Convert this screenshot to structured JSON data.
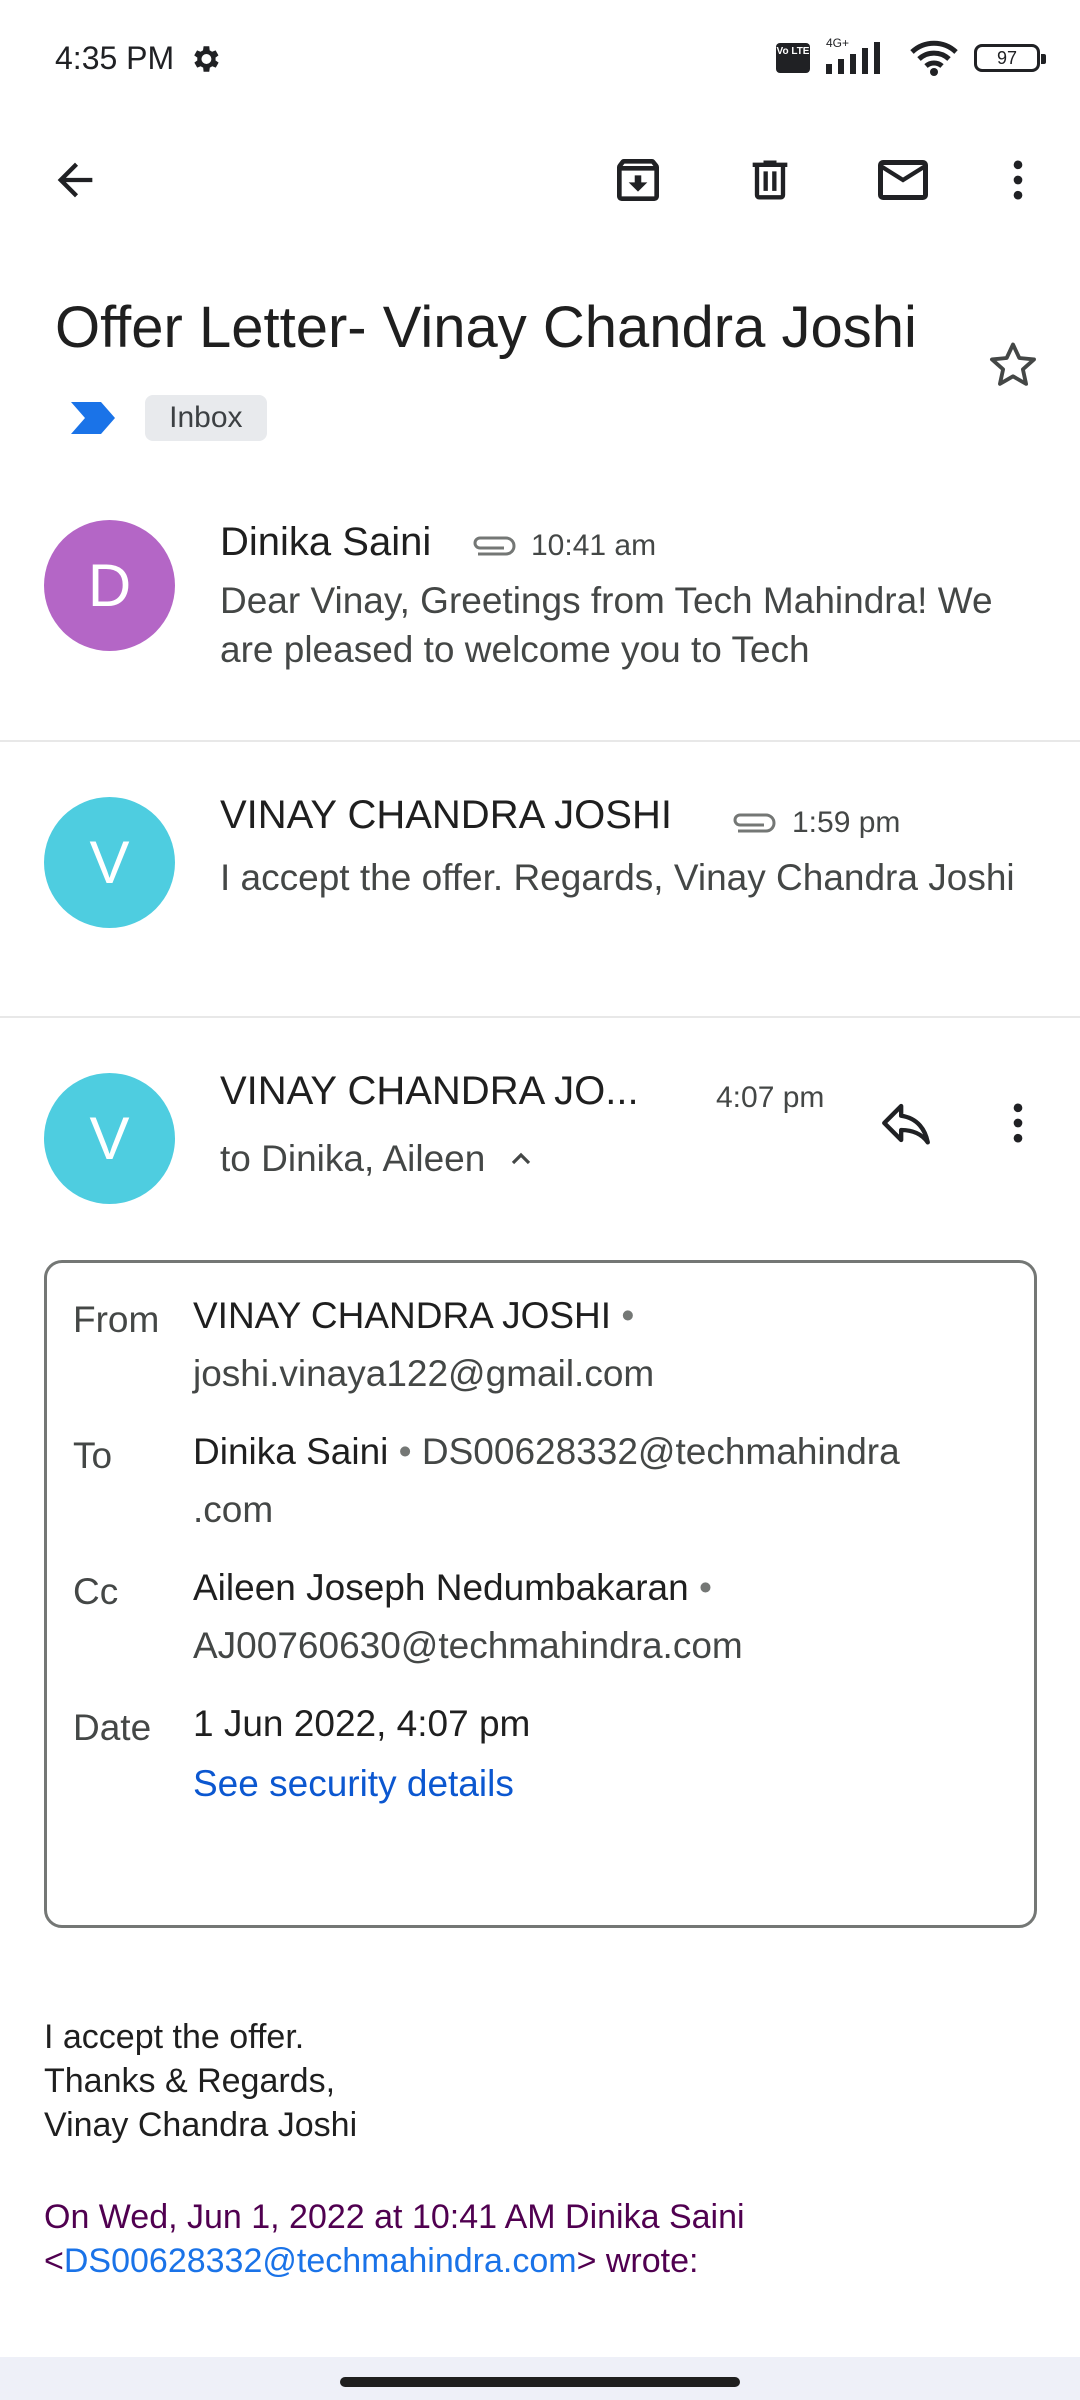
{
  "status_bar": {
    "time": "4:35 PM",
    "network_type": "4G+",
    "volte": "Vo LTE",
    "battery": "97"
  },
  "toolbar": {
    "back_icon": "arrow-back-icon",
    "archive_icon": "archive-icon",
    "delete_icon": "trash-icon",
    "mark_unread_icon": "mail-icon",
    "more_icon": "more-vert-icon"
  },
  "subject": {
    "title": "Offer Letter- Vinay Chandra Joshi",
    "label": "Inbox",
    "importance_color": "#1a73e8"
  },
  "messages": [
    {
      "avatar_letter": "D",
      "avatar_color": "#b466c6",
      "sender": "Dinika Saini",
      "time": "10:41 am",
      "snippet": "Dear Vinay, Greetings from Tech Mahindra! We are pleased to welcome you to Tech"
    },
    {
      "avatar_letter": "V",
      "avatar_color": "#4ecde0",
      "sender": "VINAY CHANDRA JOSHI",
      "time": "1:59 pm",
      "snippet": "I accept the offer. Regards, Vinay Chandra Joshi"
    }
  ],
  "open_message": {
    "avatar_letter": "V",
    "avatar_color": "#4ecde0",
    "sender": "VINAY CHANDRA JO...",
    "time": "4:07 pm",
    "recipients": "to Dinika, Aileen",
    "details": {
      "from_label": "From",
      "from_name": "VINAY CHANDRA JOSHI",
      "from_email": "joshi.vinaya122@gmail.com",
      "to_label": "To",
      "to_name": "Dinika Saini",
      "to_email_1": "DS00628332@techmahindra",
      "to_email_2": ".com",
      "cc_label": "Cc",
      "cc_name": "Aileen Joseph Nedumbakaran",
      "cc_email": "AJ00760630@techmahindra.com",
      "date_label": "Date",
      "date_value": "1 Jun 2022, 4:07 pm",
      "security_link": "See security details"
    },
    "body": {
      "line1": "I accept the offer.",
      "line2": "Thanks & Regards,",
      "line3": "Vinay Chandra Joshi"
    },
    "quote": {
      "line1": "On Wed, Jun 1, 2022 at 10:41 AM Dinika Saini",
      "open_bracket": "<",
      "email": "DS00628332@techmahindra.com",
      "close": "> wrote:"
    }
  }
}
